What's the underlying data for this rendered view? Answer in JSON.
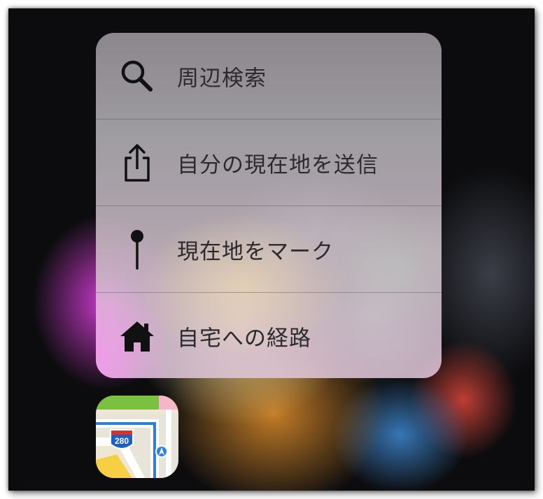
{
  "menu": {
    "items": [
      {
        "label": "周辺検索",
        "icon": "search-icon"
      },
      {
        "label": "自分の現在地を送信",
        "icon": "share-icon"
      },
      {
        "label": "現在地をマーク",
        "icon": "pin-icon"
      },
      {
        "label": "自宅への経路",
        "icon": "home-icon"
      }
    ]
  },
  "app": {
    "name": "maps-app-icon",
    "shield_number": "280"
  },
  "colors": {
    "menu_text": "#2c2a2e",
    "icon": "#111111",
    "map_green": "#7ac142",
    "map_road_blue": "#2f7fd8",
    "shield_red": "#d6312b",
    "shield_blue": "#1f5fc0"
  }
}
